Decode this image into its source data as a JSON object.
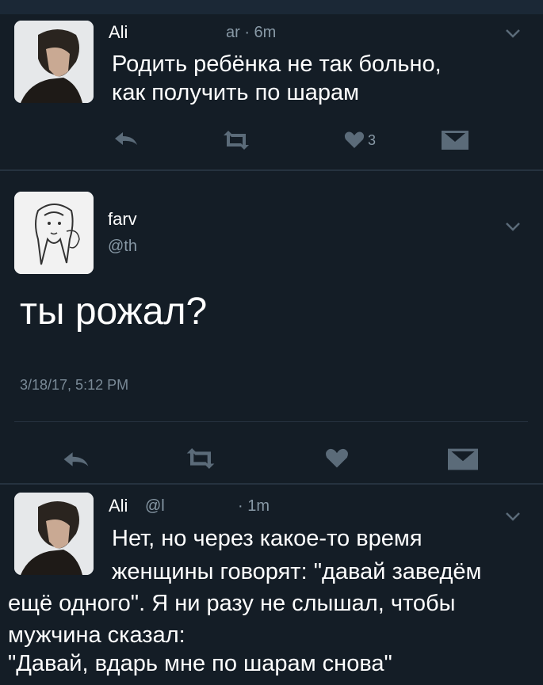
{
  "tweet1": {
    "author": "Ali",
    "time": "ar · 6m",
    "text_line1": "Родить ребёнка не так больно,",
    "text_line2": "как получить по шарам",
    "like_count": "3"
  },
  "tweet2": {
    "author": "farv",
    "handle": "@th",
    "text": "ты рожал?",
    "timestamp": "3/18/17, 5:12 PM"
  },
  "tweet3": {
    "author": "Ali",
    "handle": "@l",
    "time": "· 1m",
    "line1": "Нет, но через какое-то время",
    "line2": "женщины говорят: \"давай заведём",
    "line3": "ещё одного\". Я ни разу не слышал, чтобы",
    "line4": "мужчина сказал:",
    "line5": "\"Давай, вдарь мне по шарам снова\""
  },
  "icons": {
    "reply": "reply-icon",
    "retweet": "retweet-icon",
    "like": "heart-icon",
    "dm": "envelope-icon",
    "more": "chevron-down-icon"
  },
  "colors": {
    "background": "#141d26",
    "text": "#ffffff",
    "muted": "#8899a6",
    "icon": "#5b6b79"
  }
}
